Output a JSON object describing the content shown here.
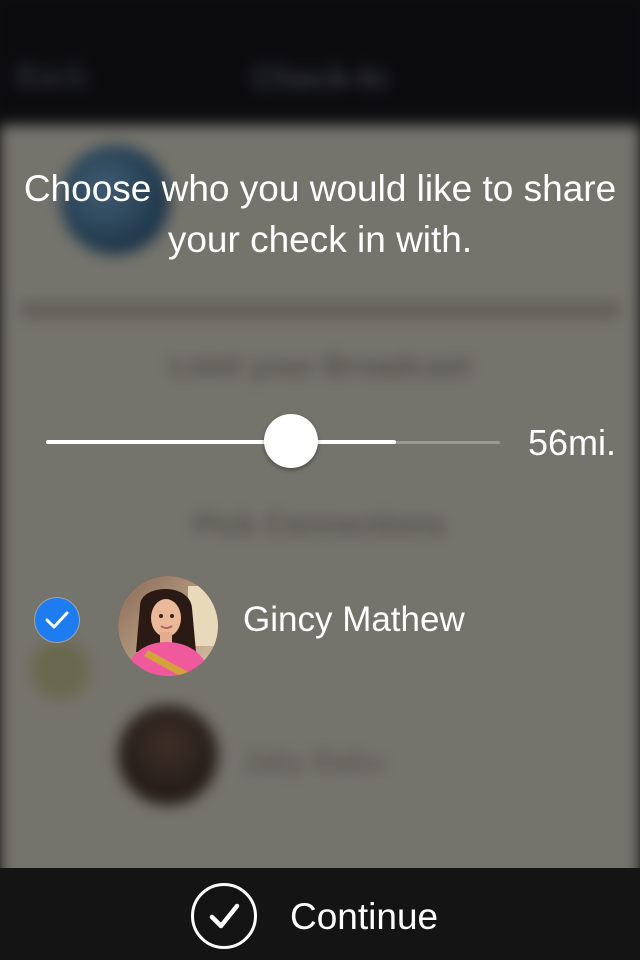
{
  "background": {
    "nav_back_label": "Back",
    "nav_title": "Check-In",
    "limit_section_label": "Limit your Broadcast",
    "pick_section_label": "Pick Connections",
    "second_contact_name": "Jaby Babu"
  },
  "prompt": {
    "text": "Choose who you would like to share your check in with."
  },
  "slider": {
    "fraction": 0.54,
    "buffered_fraction": 0.77,
    "value_label": "56mi."
  },
  "contact": {
    "name": "Gincy Mathew",
    "selected": true,
    "check_color": "#1c7cf0"
  },
  "footer": {
    "continue_label": "Continue"
  },
  "icons": {
    "checkmark": "checkmark-icon",
    "continue": "check-circle-icon",
    "avatar": "avatar"
  }
}
